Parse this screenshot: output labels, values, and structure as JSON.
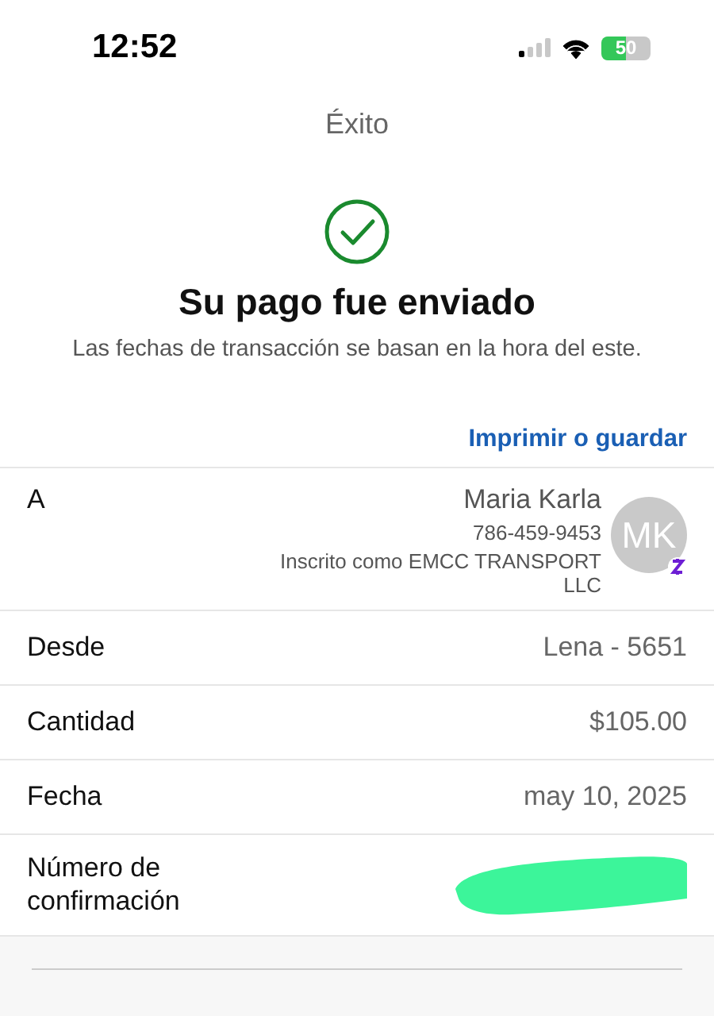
{
  "status_bar": {
    "time": "12:52",
    "battery": "50"
  },
  "header": {
    "title": "Éxito"
  },
  "result": {
    "heading": "Su pago fue enviado",
    "note": "Las fechas de transacción se basan en la hora del este."
  },
  "print_link": "Imprimir o guardar",
  "recipient": {
    "label": "A",
    "name": "Maria Karla",
    "phone": "786-459-9453",
    "enrolled": "Inscrito como EMCC TRANSPORT LLC",
    "initials": "MK"
  },
  "details": [
    {
      "label": "Desde",
      "value": "Lena - 5651",
      "redacted": false
    },
    {
      "label": "Cantidad",
      "value": "$105.00",
      "redacted": false
    },
    {
      "label": "Fecha",
      "value": "may 10, 2025",
      "redacted": false
    },
    {
      "label": "Número de confirmación",
      "redacted": true
    }
  ]
}
